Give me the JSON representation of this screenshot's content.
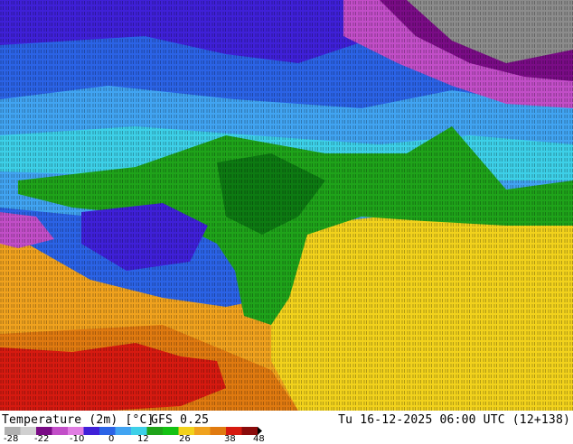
{
  "map": {
    "field": "temperature-2m",
    "palette": {
      "deep_cold": "#7a0c86",
      "cold_magenta": "#c24ec8",
      "violet": "#3f20d8",
      "blue": "#2b63e6",
      "sky": "#41a4f2",
      "cyan": "#3dd0e8",
      "green": "#1fa31a",
      "dark_green": "#0d7a12",
      "yellow": "#f2d21c",
      "orange": "#f0a21e",
      "dark_orange": "#e07a10",
      "red": "#d61a10",
      "gray": "#8c8c8c"
    }
  },
  "footer": {
    "title": "Temperature (2m) [°C]",
    "model": "GFS 0.25",
    "valid_time": "Tu 16-12-2025 06:00 UTC (12+138)"
  },
  "legend": {
    "ticks": [
      "-28",
      "-22",
      "-10",
      "0",
      "12",
      "26",
      "38",
      "48"
    ],
    "colors": [
      "#b0b0b0",
      "#d0d0d0",
      "#7a0c86",
      "#c24ec8",
      "#e07de2",
      "#3f20d8",
      "#2b63e6",
      "#41a4f2",
      "#3dd0e8",
      "#1fa31a",
      "#14c214",
      "#f2d21c",
      "#f0a21e",
      "#e07a10",
      "#d61a10",
      "#8a0c0c"
    ]
  }
}
